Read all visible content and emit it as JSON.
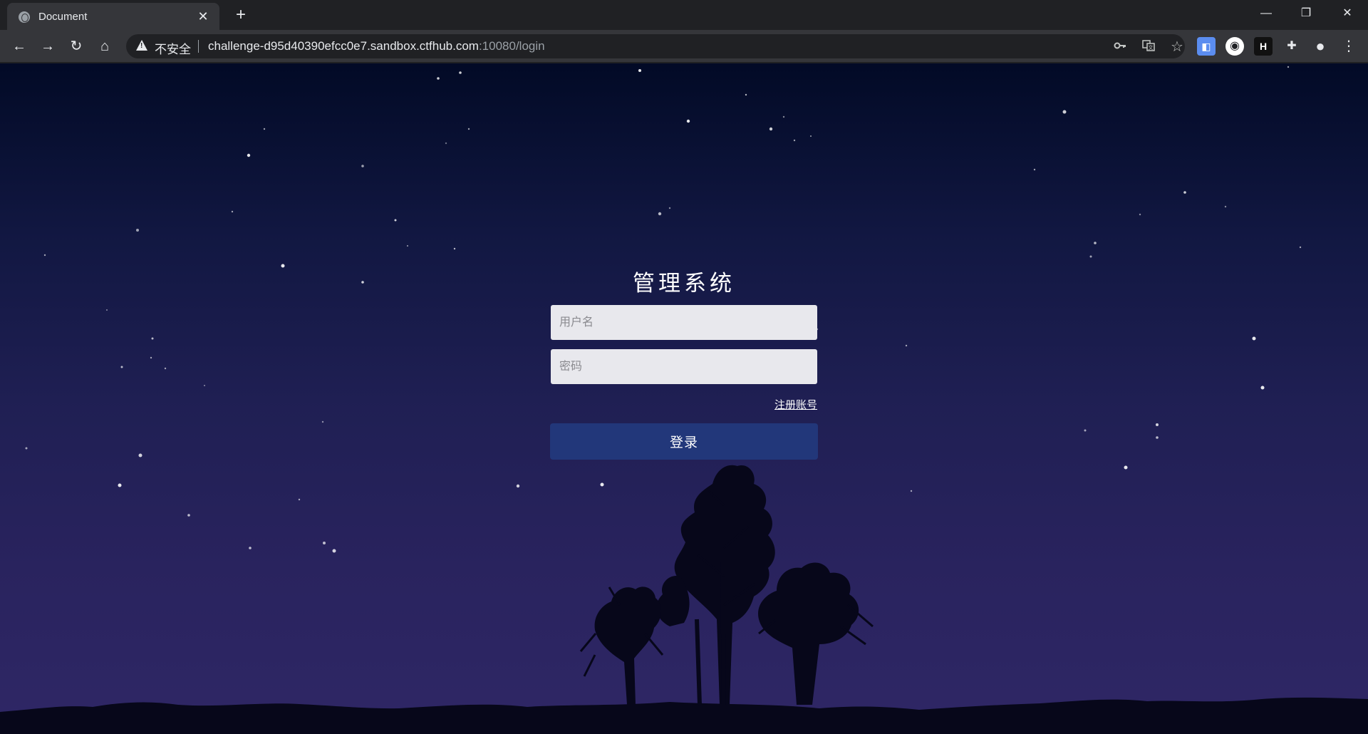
{
  "browser": {
    "tab_title": "Document",
    "tab_close": "✕",
    "new_tab": "+",
    "security_label": "不安全",
    "url_host": "challenge-d95d40390efcc0e7.sandbox.ctfhub.com",
    "url_rest": ":10080/login",
    "nav": {
      "back": "←",
      "forward": "→",
      "reload": "↻",
      "home": "⌂"
    },
    "window": {
      "minimize": "—",
      "restore": "❐",
      "close": "✕"
    },
    "icons": {
      "key": "key-icon",
      "translate": "translate-icon",
      "bookmark": "☆"
    },
    "extensions": {
      "ext1": "◧",
      "ext2": "◉",
      "ext3": "H",
      "puzzle": "✚",
      "profile": "●",
      "menu": "⋮"
    }
  },
  "login": {
    "title": "管理系统",
    "username_placeholder": "用户名",
    "password_placeholder": "密码",
    "register_link": "注册账号",
    "submit_label": "登录"
  },
  "colors": {
    "button": "#22377a",
    "input_bg": "#e8e8ed"
  }
}
